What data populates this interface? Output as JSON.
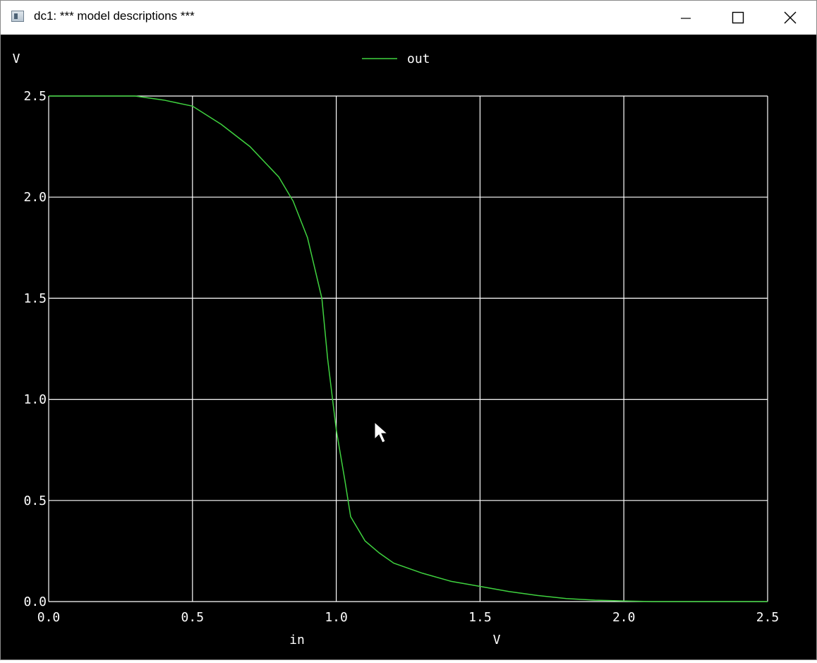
{
  "window": {
    "title": "dc1: *** model descriptions ***",
    "icon": "app-window-icon",
    "controls": {
      "minimize": "minimize-icon",
      "maximize": "maximize-icon",
      "close": "close-icon"
    }
  },
  "colors": {
    "background": "#000000",
    "grid": "#ffffff",
    "trace": "#3fd23f"
  },
  "chart_data": {
    "type": "line",
    "ylabel": "V",
    "xlabel": "in",
    "xunit": "V",
    "xlim": [
      0.0,
      2.5
    ],
    "ylim": [
      0.0,
      2.5
    ],
    "xticks": [
      "0.0",
      "0.5",
      "1.0",
      "1.5",
      "2.0",
      "2.5"
    ],
    "yticks": [
      "0.0",
      "0.5",
      "1.0",
      "1.5",
      "2.0",
      "2.5"
    ],
    "grid": true,
    "legend": "top-center",
    "series": [
      {
        "name": "out",
        "x": [
          0.0,
          0.3,
          0.4,
          0.5,
          0.6,
          0.7,
          0.8,
          0.85,
          0.9,
          0.95,
          0.97,
          1.0,
          1.03,
          1.05,
          1.1,
          1.15,
          1.2,
          1.3,
          1.4,
          1.5,
          1.6,
          1.7,
          1.8,
          1.9,
          2.0,
          2.1,
          2.5
        ],
        "y": [
          2.5,
          2.5,
          2.48,
          2.45,
          2.36,
          2.25,
          2.1,
          1.98,
          1.8,
          1.5,
          1.2,
          0.85,
          0.6,
          0.42,
          0.3,
          0.24,
          0.19,
          0.14,
          0.1,
          0.075,
          0.05,
          0.03,
          0.015,
          0.007,
          0.003,
          0.0,
          0.0
        ]
      }
    ]
  }
}
